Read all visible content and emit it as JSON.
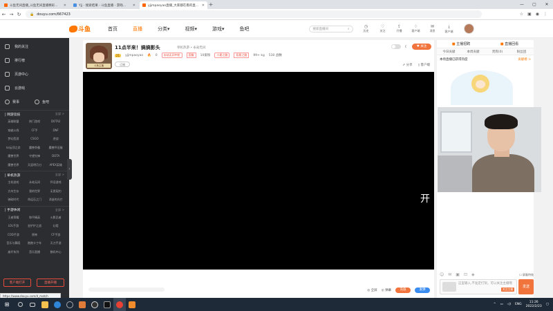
{
  "browser": {
    "tabs": [
      {
        "title": "斗鱼无间直播_斗鱼无间直播精彩...",
        "active": false
      },
      {
        "title": "Yjj - 搜索结果 - 斗鱼直播 - 游戏...",
        "active": false
      },
      {
        "title": "yjjmpaoyao直播_大家都在看的直...",
        "active": true
      }
    ],
    "url": "douyu.com/667423",
    "status_url": "https://www.douyu.com/d_match"
  },
  "site": {
    "logo_text": "斗鱼",
    "nav": [
      {
        "label": "首页",
        "active": false
      },
      {
        "label": "直播",
        "active": true
      },
      {
        "label": "分类▾",
        "active": false
      },
      {
        "label": "视频▾",
        "active": false
      },
      {
        "label": "游戏▾",
        "active": false
      },
      {
        "label": "鱼吧",
        "active": false
      }
    ],
    "search_placeholder": "搜索直播间",
    "header_icons": [
      {
        "icon": "history-icon",
        "label": "历史"
      },
      {
        "icon": "heart-icon",
        "label": "关注"
      },
      {
        "icon": "upload-icon",
        "label": "开播"
      },
      {
        "icon": "bell-icon",
        "label": "客户端"
      },
      {
        "icon": "message-icon",
        "label": "消息"
      },
      {
        "icon": "download-icon",
        "label": "客户端"
      }
    ]
  },
  "sidebar": {
    "main_items": [
      {
        "icon": "heart-icon",
        "label": "我的关注"
      },
      {
        "icon": "rank-icon",
        "label": "排行榜"
      },
      {
        "icon": "video-icon",
        "label": "页游中心"
      },
      {
        "icon": "cloud-icon",
        "label": "云游戏"
      }
    ],
    "row_items": [
      {
        "label": "赛事"
      },
      {
        "label": "鱼吧"
      }
    ],
    "categories": [
      {
        "title": "| 网游竞技",
        "more": "全部 >",
        "items": [
          "英雄联盟",
          "热门游戏",
          "DOTA2",
          "穿越火线",
          "CF手",
          "DNF",
          "梦幻西游",
          "CSGO",
          "逆战",
          "lol云顶之弈",
          "魔兽争霸",
          "魔兽怀旧服",
          "魔兽世界",
          "守望先锋",
          "DOTA",
          "魔兽世界",
          "天涯明月刀",
          "APEX英雄"
        ]
      },
      {
        "title": "| 单机热游",
        "more": "全部 >",
        "items": [
          "主机游戏",
          "永劫无间",
          "怀旧游戏",
          "方舟生存",
          "我的世界",
          "无畏契约",
          "骑砍时代",
          "命运石之门",
          "消逝的光芒"
        ]
      },
      {
        "title": "| 手游休闲",
        "more": "全部 >",
        "items": [
          "王者荣耀",
          "和平精英",
          "火影忍者",
          "LOL手游",
          "金铲铲之战",
          "幻塔",
          "COD手游",
          "原神",
          "CF手游",
          "音乐与舞蹈",
          "跑跑卡丁车",
          "天刀手游",
          "崩坏系列",
          "音乐直播",
          "数码中心"
        ]
      }
    ],
    "bottom_buttons": [
      "客户端打开",
      "直播开播"
    ]
  },
  "room": {
    "title": "11点半来！搞搞影头",
    "category": "单机热游 • 永劫无间",
    "anchor_level": "21",
    "anchor_name": "yjjmpaoyao",
    "hot": "0",
    "tag1": "永劫无间中阶",
    "tag2": "国服",
    "tag3": "小星之路",
    "tag4": "双星之路",
    "fans": "10爱粉",
    "followers": "99+ kg",
    "extra": "530 战数",
    "follow_label": "订阅",
    "like_label": "关注",
    "tools": [
      "分享",
      "客户端"
    ],
    "avatar_chip": "斗鱼主播"
  },
  "overlay_text": "开",
  "player_bottom": {
    "b1": "全屏",
    "b2": "弹幕",
    "btn1": "充值",
    "btn2": "发弹"
  },
  "rightpanel": {
    "top_tabs": [
      "主播招聘",
      "直播回看"
    ],
    "tabs": [
      "今日贡献",
      "本周贡献",
      "贵宾(0)",
      "粉丝团"
    ],
    "sub_left": "本场直播已获得热度",
    "sub_link": "贡献榜 >"
  },
  "chat": {
    "input_hint": "这里输入,不准定打架。可以关注主播哦",
    "follow_btn": "关注主播",
    "send_label": "发送",
    "block_label": "屏蔽特效"
  },
  "taskbar": {
    "lang": "ENG",
    "time": "11:26",
    "date": "2022/2/23"
  }
}
